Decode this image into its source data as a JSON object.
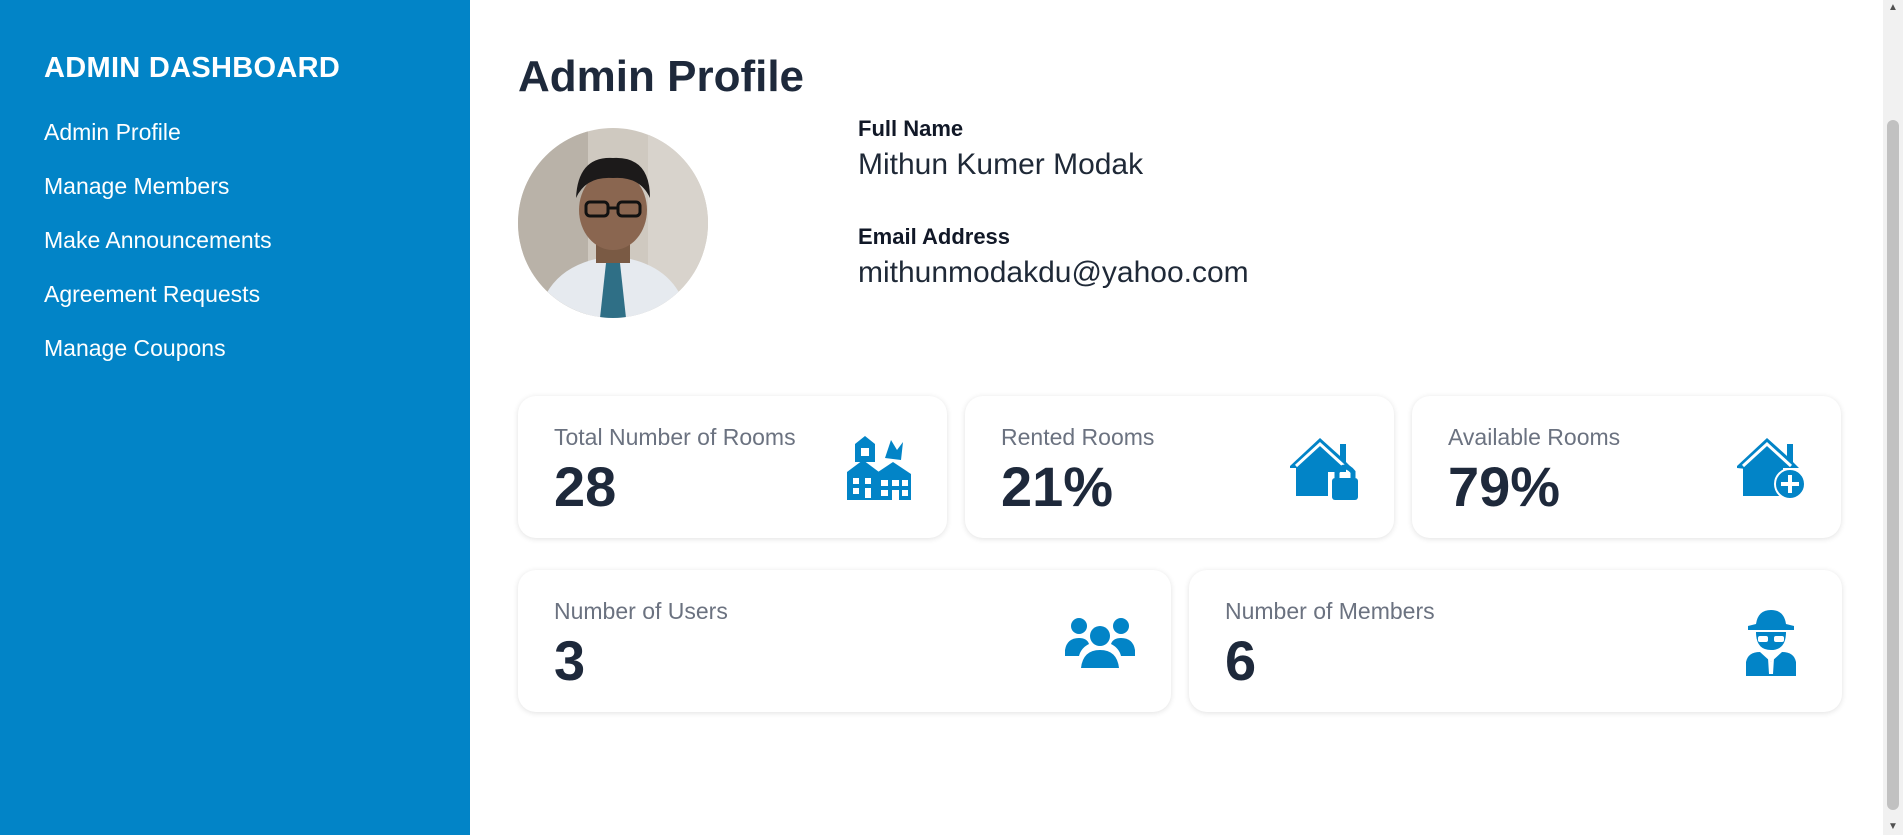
{
  "sidebar": {
    "title": "ADMIN DASHBOARD",
    "items": [
      {
        "label": "Admin Profile"
      },
      {
        "label": "Manage Members"
      },
      {
        "label": "Make Announcements"
      },
      {
        "label": "Agreement Requests"
      },
      {
        "label": "Manage Coupons"
      }
    ]
  },
  "main": {
    "title": "Admin Profile",
    "profile": {
      "name_label": "Full Name",
      "name": "Mithun Kumer Modak",
      "email_label": "Email Address",
      "email": "mithunmodakdu@yahoo.com"
    },
    "stats": [
      {
        "label": "Total Number of Rooms",
        "value": "28",
        "icon": "buildings-icon"
      },
      {
        "label": "Rented Rooms",
        "value": "21%",
        "icon": "house-lock-icon"
      },
      {
        "label": "Available Rooms",
        "value": "79%",
        "icon": "house-plus-icon"
      },
      {
        "label": "Number of Users",
        "value": "3",
        "icon": "users-icon"
      },
      {
        "label": "Number of Members",
        "value": "6",
        "icon": "user-secret-icon"
      }
    ]
  },
  "colors": {
    "sidebar_bg": "#0284c7",
    "accent_icon": "#0284c7",
    "text_dark": "#1e293b",
    "text_muted": "#6b7280"
  }
}
